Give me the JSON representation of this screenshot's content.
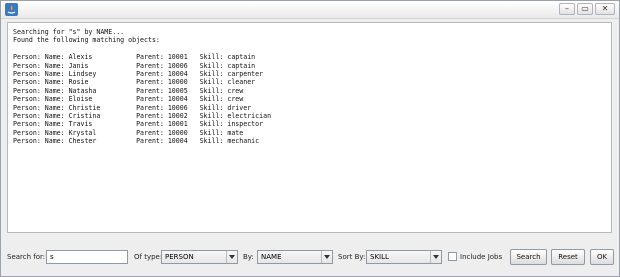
{
  "window": {
    "title": "",
    "controls": {
      "minimize": "–",
      "maximize": "▭",
      "close": "✕"
    }
  },
  "output": {
    "lines": [
      "Searching for \"s\" by NAME...",
      "Found the following matching objects:",
      "",
      "Person: Name: Alexis           Parent: 10001   Skill: captain",
      "Person: Name: Janis            Parent: 10006   Skill: captain",
      "Person: Name: Lindsey          Parent: 10004   Skill: carpenter",
      "Person: Name: Rosie            Parent: 10000   Skill: cleaner",
      "Person: Name: Natasha          Parent: 10005   Skill: crew",
      "Person: Name: Eloise           Parent: 10004   Skill: crew",
      "Person: Name: Christie         Parent: 10006   Skill: driver",
      "Person: Name: Cristina         Parent: 10002   Skill: electrician",
      "Person: Name: Travis           Parent: 10001   Skill: inspector",
      "Person: Name: Krystal          Parent: 10000   Skill: mate",
      "Person: Name: Chester          Parent: 10004   Skill: mechanic"
    ]
  },
  "controls": {
    "search_label": "Search for:",
    "search_value": "s",
    "type_label": "Of type:",
    "type_value": "PERSON",
    "by_label": "By:",
    "by_value": "NAME",
    "sort_label": "Sort By:",
    "sort_value": "SKILL",
    "include_jobs_label": "Include Jobs",
    "include_jobs_checked": false,
    "search_button": "Search",
    "reset_button": "Reset",
    "ok_button": "OK"
  }
}
